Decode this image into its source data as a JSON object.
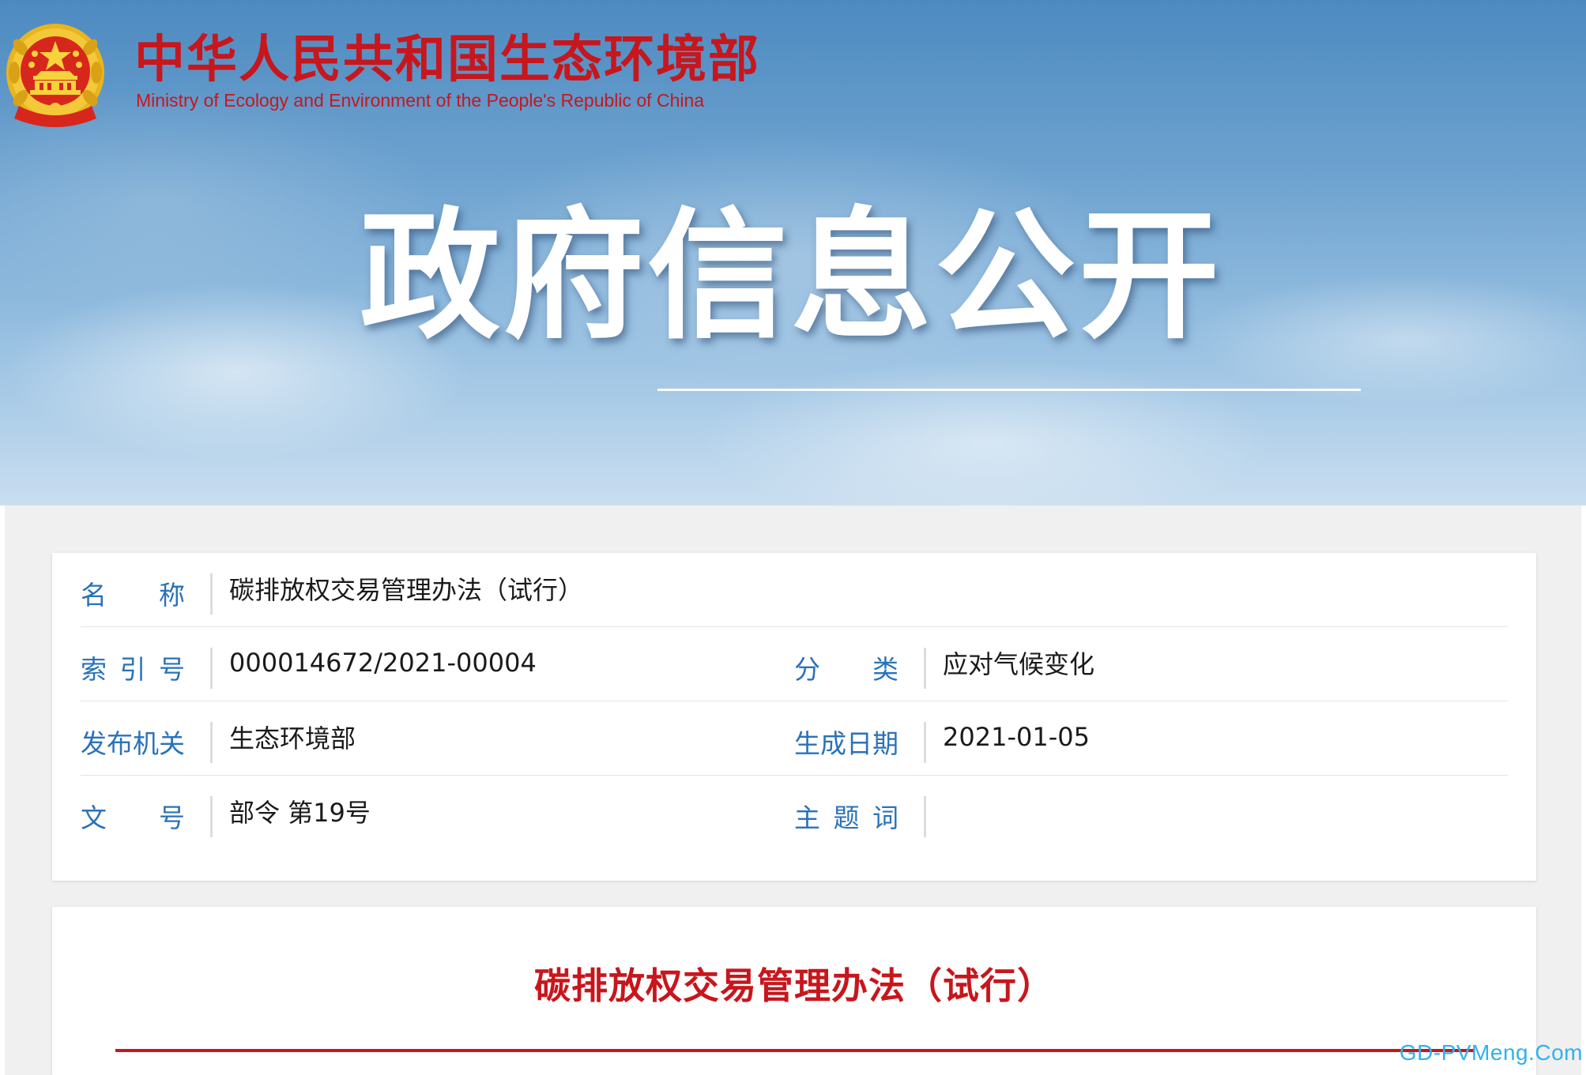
{
  "header": {
    "site_title_cn": "中华人民共和国生态环境部",
    "site_title_en": "Ministry of Ecology and Environment of the People's Republic of China",
    "emblem_icon": "national-emblem-icon",
    "banner_heading": "政府信息公开"
  },
  "info": {
    "name": {
      "label": [
        "名",
        "称"
      ],
      "value": "碳排放权交易管理办法（试行）"
    },
    "index_no": {
      "label": [
        "索",
        "引",
        "号"
      ],
      "value": "000014672/2021-00004"
    },
    "category": {
      "label": [
        "分",
        "类"
      ],
      "value": "应对气候变化"
    },
    "issuer": {
      "label": [
        "发",
        "布",
        "机",
        "关"
      ],
      "value": "生态环境部"
    },
    "date": {
      "label": [
        "生",
        "成",
        "日",
        "期"
      ],
      "value": "2021-01-05"
    },
    "doc_no": {
      "label": [
        "文",
        "号"
      ],
      "value": "部令 第19号"
    },
    "keywords": {
      "label": [
        "主",
        "题",
        "词"
      ],
      "value": ""
    }
  },
  "document": {
    "title": "碳排放权交易管理办法（试行）"
  },
  "watermark": "GD-PVMeng.Com",
  "colors": {
    "brand_red": "#c8161d",
    "label_blue": "#2a72b9",
    "watermark_cyan": "#2fb3ea",
    "page_gray": "#f0f0f0"
  }
}
